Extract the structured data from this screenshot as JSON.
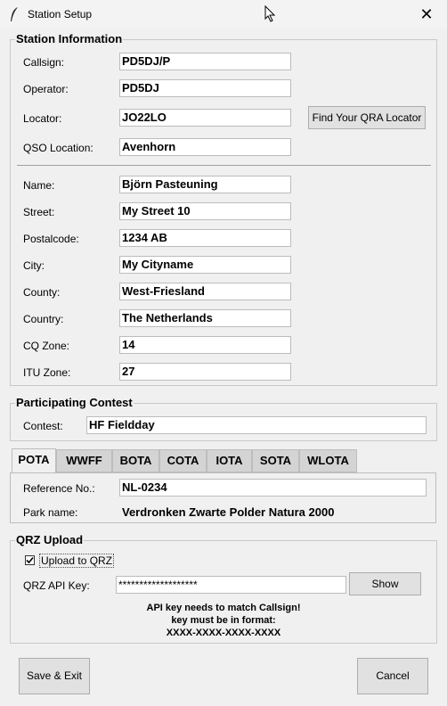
{
  "window": {
    "title": "Station Setup",
    "close": "✕"
  },
  "station": {
    "title": "Station Information",
    "callsign": {
      "label": "Callsign:",
      "value": "PD5DJ/P"
    },
    "operator": {
      "label": "Operator:",
      "value": "PD5DJ"
    },
    "locator": {
      "label": "Locator:",
      "value": "JO22LO"
    },
    "find_locator_button": "Find Your QRA Locator",
    "qso_location": {
      "label": "QSO Location:",
      "value": "Avenhorn"
    },
    "name": {
      "label": "Name:",
      "value": "Björn Pasteuning"
    },
    "street": {
      "label": "Street:",
      "value": "My Street 10"
    },
    "postalcode": {
      "label": "Postalcode:",
      "value": "1234 AB"
    },
    "city": {
      "label": "City:",
      "value": "My Cityname"
    },
    "county": {
      "label": "County:",
      "value": "West-Friesland"
    },
    "country": {
      "label": "Country:",
      "value": "The Netherlands"
    },
    "cq_zone": {
      "label": "CQ Zone:",
      "value": "14"
    },
    "itu_zone": {
      "label": "ITU Zone:",
      "value": "27"
    }
  },
  "contest": {
    "title": "Participating Contest",
    "label": "Contest:",
    "value": "HF Fieldday"
  },
  "programs": {
    "tabs": [
      "POTA",
      "WWFF",
      "BOTA",
      "COTA",
      "IOTA",
      "SOTA",
      "WLOTA"
    ],
    "active": "POTA",
    "reference": {
      "label": "Reference No.:",
      "value": "NL-0234"
    },
    "park": {
      "label": "Park name:",
      "value": "Verdronken Zwarte Polder Natura 2000"
    }
  },
  "qrz": {
    "title": "QRZ Upload",
    "upload_label": "Upload to QRZ",
    "upload_checked": true,
    "api_key_label": "QRZ API Key:",
    "api_key_value": "*******************",
    "show_button": "Show",
    "note_line1": "API key needs to match Callsign!",
    "note_line2": "key must be in format:",
    "note_line3": "XXXX-XXXX-XXXX-XXXX"
  },
  "buttons": {
    "save": "Save & Exit",
    "cancel": "Cancel"
  }
}
